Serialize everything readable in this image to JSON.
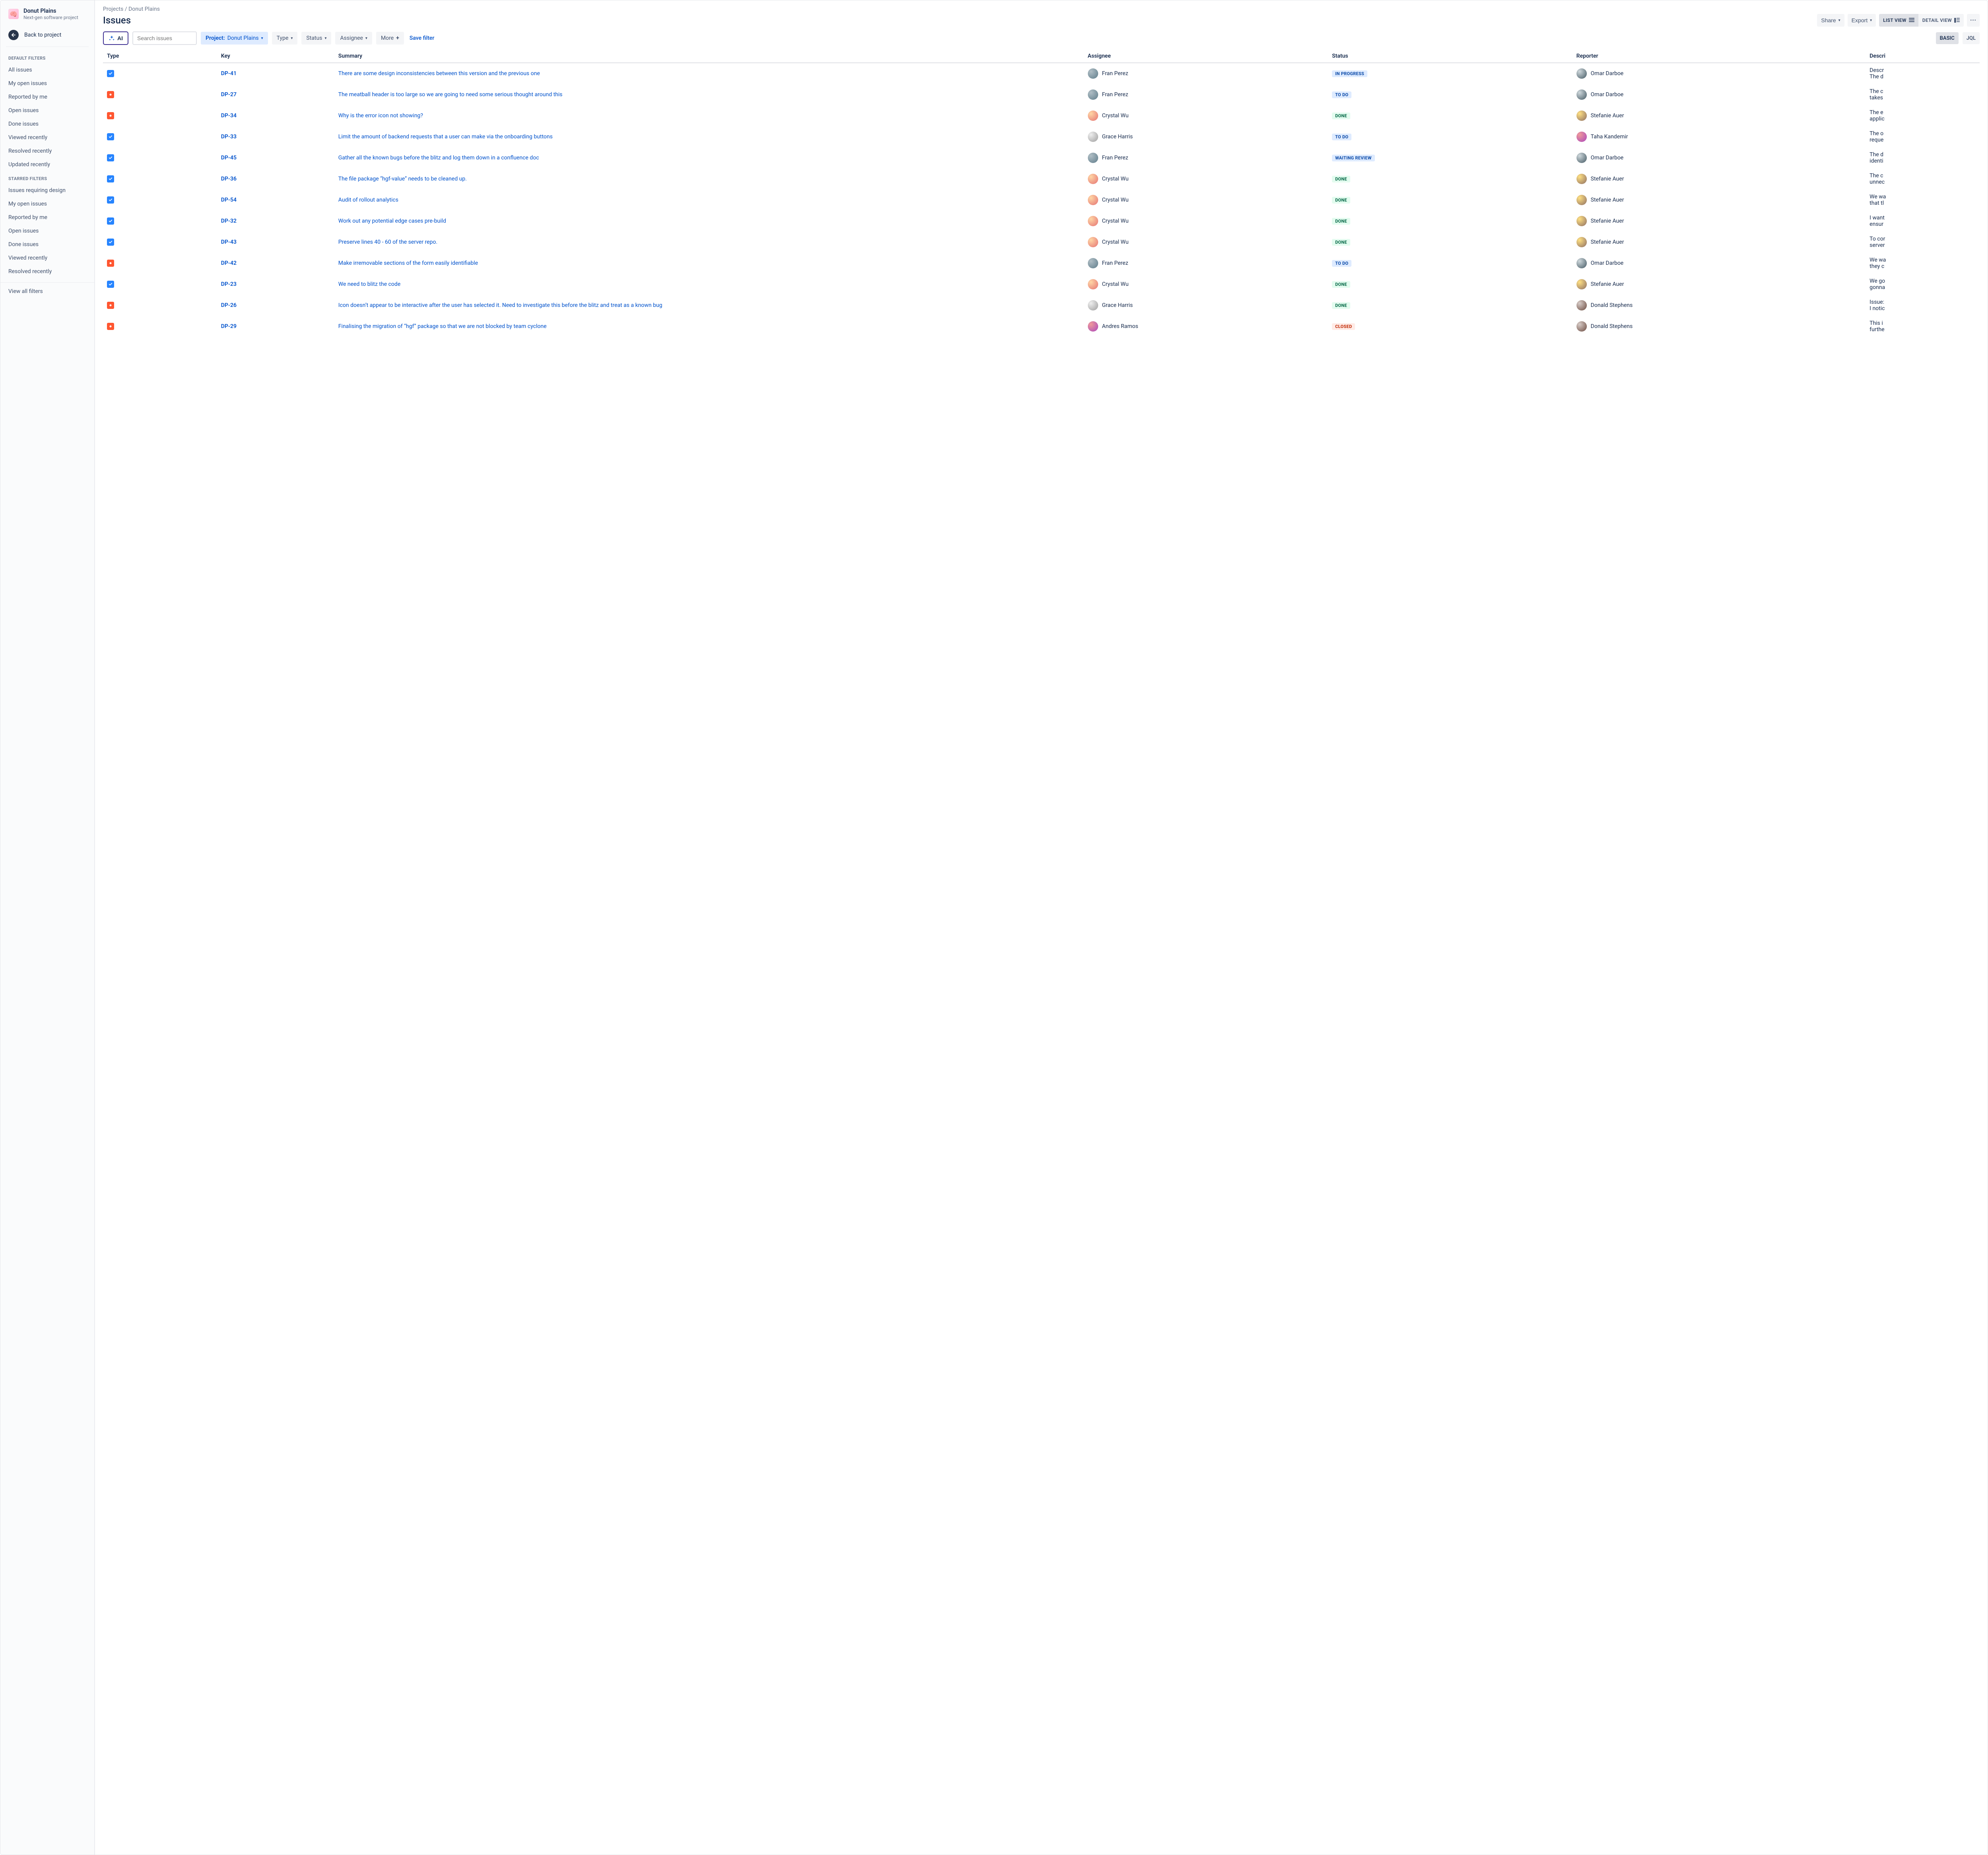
{
  "project": {
    "name": "Donut Plains",
    "subtitle": "Next-gen software project",
    "icon_emoji": "🧠"
  },
  "back_label": "Back to project",
  "sidebar": {
    "default_heading": "DEFAULT FILTERS",
    "default_items": [
      "All issues",
      "My open issues",
      "Reported by me",
      "Open issues",
      "Done issues",
      "Viewed recently",
      "Resolved recently",
      "Updated recently"
    ],
    "starred_heading": "STARRED FILTERS",
    "starred_items": [
      "Issues requiring design",
      "My open issues",
      "Reported by me",
      "Open issues",
      "Done issues",
      "Viewed recently",
      "Resolved recently"
    ],
    "view_all": "View all filters"
  },
  "breadcrumb": {
    "p1": "Projects",
    "sep": " / ",
    "p2": "Donut Plains"
  },
  "page_title": "Issues",
  "actions": {
    "share": "Share",
    "export": "Export",
    "list_view": "LIST VIEW",
    "detail_view": "DETAIL VIEW"
  },
  "filterbar": {
    "ai_label": "AI",
    "search_placeholder": "Search issues",
    "project_label": "Project:",
    "project_value": "Donut Plains",
    "type": "Type",
    "status": "Status",
    "assignee": "Assignee",
    "more": "More",
    "save": "Save filter",
    "basic": "BASIC",
    "jql": "JQL"
  },
  "columns": {
    "type": "Type",
    "key": "Key",
    "summary": "Summary",
    "assignee": "Assignee",
    "status": "Status",
    "reporter": "Reporter",
    "description": "Descri"
  },
  "rows": [
    {
      "type": "task",
      "key": "DP-41",
      "summary": "There are some design inconsistencies between this version and the previous one",
      "assignee": "Fran Perez",
      "assignee_av": "av-a",
      "status": "IN PROGRESS",
      "status_cls": "st-inprogress",
      "reporter": "Omar Darboe",
      "reporter_av": "av-f",
      "desc": "Descr\nThe d"
    },
    {
      "type": "bug",
      "key": "DP-27",
      "summary": "The meatball header is too large so we are going to need some serious thought around this",
      "assignee": "Fran Perez",
      "assignee_av": "av-a",
      "status": "TO DO",
      "status_cls": "st-todo",
      "reporter": "Omar Darboe",
      "reporter_av": "av-f",
      "desc": "The c\ntakes"
    },
    {
      "type": "bug",
      "key": "DP-34",
      "summary": "Why is the error icon not showing?",
      "assignee": "Crystal Wu",
      "assignee_av": "av-b",
      "status": "DONE",
      "status_cls": "st-done",
      "reporter": "Stefanie Auer",
      "reporter_av": "av-e",
      "desc": "The e\napplic"
    },
    {
      "type": "task",
      "key": "DP-33",
      "summary": "Limit the amount of backend requests that a user can make via the onboarding buttons",
      "assignee": "Grace Harris",
      "assignee_av": "av-c",
      "status": "TO DO",
      "status_cls": "st-todo",
      "reporter": "Taha Kandemir",
      "reporter_av": "av-d",
      "desc": "The o\nreque"
    },
    {
      "type": "task",
      "key": "DP-45",
      "summary": "Gather all the known bugs before the blitz and log them down in a confluence doc",
      "assignee": "Fran Perez",
      "assignee_av": "av-a",
      "status": "WAITING REVIEW",
      "status_cls": "st-waiting",
      "reporter": "Omar Darboe",
      "reporter_av": "av-f",
      "desc": "The d\nidenti"
    },
    {
      "type": "task",
      "key": "DP-36",
      "summary": "The file package “hgf-value” needs to be cleaned up.",
      "assignee": "Crystal Wu",
      "assignee_av": "av-b",
      "status": "DONE",
      "status_cls": "st-done",
      "reporter": "Stefanie Auer",
      "reporter_av": "av-e",
      "desc": "The c\nunnec"
    },
    {
      "type": "task",
      "key": "DP-54",
      "summary": "Audit of rollout analytics",
      "assignee": "Crystal Wu",
      "assignee_av": "av-b",
      "status": "DONE",
      "status_cls": "st-done",
      "reporter": "Stefanie Auer",
      "reporter_av": "av-e",
      "desc": "We wa\nthat tl"
    },
    {
      "type": "task",
      "key": "DP-32",
      "summary": "Work out any potential edge cases pre-build",
      "assignee": "Crystal Wu",
      "assignee_av": "av-b",
      "status": "DONE",
      "status_cls": "st-done",
      "reporter": "Stefanie Auer",
      "reporter_av": "av-e",
      "desc": "I want\nensur"
    },
    {
      "type": "task",
      "key": "DP-43",
      "summary": "Preserve lines 40 - 60 of the server repo.",
      "assignee": "Crystal Wu",
      "assignee_av": "av-b",
      "status": "DONE",
      "status_cls": "st-done",
      "reporter": "Stefanie Auer",
      "reporter_av": "av-e",
      "desc": "To cor\nserver"
    },
    {
      "type": "bug",
      "key": "DP-42",
      "summary": "Make irremovable sections of the form easily identifiable",
      "assignee": "Fran Perez",
      "assignee_av": "av-a",
      "status": "TO DO",
      "status_cls": "st-todo",
      "reporter": "Omar Darboe",
      "reporter_av": "av-f",
      "desc": "We wa\nthey c"
    },
    {
      "type": "task",
      "key": "DP-23",
      "summary": "We need to blitz the code",
      "assignee": "Crystal Wu",
      "assignee_av": "av-b",
      "status": "DONE",
      "status_cls": "st-done",
      "reporter": "Stefanie Auer",
      "reporter_av": "av-e",
      "desc": "We go\ngonna"
    },
    {
      "type": "bug",
      "key": "DP-26",
      "summary": "Icon doesn’t appear to be interactive after the user has selected it. Need to investigate this before the blitz and treat as a known bug",
      "assignee": "Grace Harris",
      "assignee_av": "av-c",
      "status": "DONE",
      "status_cls": "st-done",
      "reporter": "Donald Stephens",
      "reporter_av": "av-g",
      "desc": "Issue:\nI notic"
    },
    {
      "type": "bug",
      "key": "DP-29",
      "summary": "Finalising the migration of “hgf” package so that we are not blocked by team cyclone",
      "assignee": "Andres Ramos",
      "assignee_av": "av-d",
      "status": "CLOSED",
      "status_cls": "st-closed",
      "reporter": "Donald Stephens",
      "reporter_av": "av-g",
      "desc": "This i\nfurthe"
    }
  ]
}
